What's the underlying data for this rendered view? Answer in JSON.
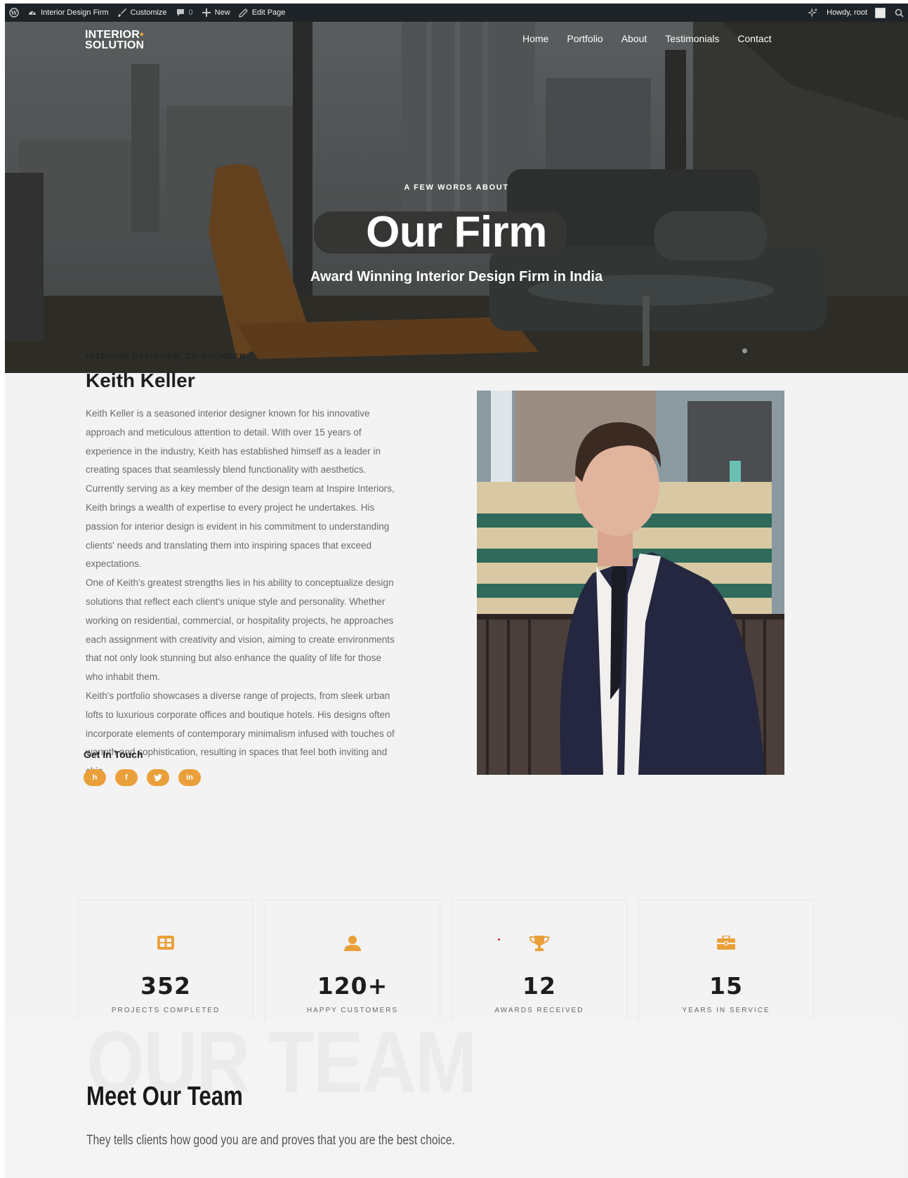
{
  "adminbar": {
    "site_name": "Interior Design Firm",
    "customize": "Customize",
    "comments_count": "0",
    "new": "New",
    "edit_page": "Edit Page",
    "howdy": "Howdy, root"
  },
  "header": {
    "logo_line1": "INTERIOR",
    "logo_line2": "SOLUTION",
    "nav": [
      "Home",
      "Portfolio",
      "About",
      "Testimonials",
      "Contact"
    ]
  },
  "hero": {
    "eyebrow": "A FEW WORDS ABOUT",
    "title": "Our Firm",
    "subtitle": "Award Winning Interior Design Firm in India"
  },
  "profile": {
    "role": "INTERIOR DESIGNER, CO-FOUNDER",
    "name": "Keith Keller",
    "bio": [
      "Keith Keller is a seasoned interior designer known for his innovative approach and meticulous attention to detail. With over 15 years of experience in the industry, Keith has established himself as a leader in creating spaces that seamlessly blend functionality with aesthetics. Currently serving as a key member of the design team at Inspire Interiors, Keith brings a wealth of expertise to every project he undertakes. His passion for interior design is evident in his commitment to understanding clients' needs and translating them into inspiring spaces that exceed expectations.",
      "One of Keith's greatest strengths lies in his ability to conceptualize design solutions that reflect each client's unique style and personality. Whether working on residential, commercial, or hospitality projects, he approaches each assignment with creativity and vision, aiming to create environments that not only look stunning but also enhance the quality of life for those who inhabit them.",
      "Keith's portfolio showcases a diverse range of projects, from sleek urban lofts to luxurious corporate offices and boutique hotels. His designs often incorporate elements of contemporary minimalism infused with touches of warmth and sophistication, resulting in spaces that feel both inviting and chic."
    ],
    "get_in_touch": "Get In Touch",
    "socials": [
      {
        "icon": "houzz-icon",
        "glyph": "h"
      },
      {
        "icon": "facebook-icon",
        "glyph": "f"
      },
      {
        "icon": "twitter-icon",
        "glyph": "t"
      },
      {
        "icon": "linkedin-icon",
        "glyph": "in"
      }
    ]
  },
  "stats": [
    {
      "icon": "grid-icon",
      "value": "352",
      "label": "PROJECTS COMPLETED"
    },
    {
      "icon": "user-icon",
      "value": "120+",
      "label": "HAPPY CUSTOMERS"
    },
    {
      "icon": "trophy-icon",
      "value": "12",
      "label": "AWARDS RECEIVED"
    },
    {
      "icon": "briefcase-icon",
      "value": "15",
      "label": "YEARS IN SERVICE"
    }
  ],
  "team": {
    "background_word": "OUR TEAM",
    "title": "Meet Our Team",
    "subtitle": "They tells clients how good you are and proves that you are the best choice."
  },
  "colors": {
    "accent": "#eaa03a",
    "adminbar": "#1d2327"
  }
}
